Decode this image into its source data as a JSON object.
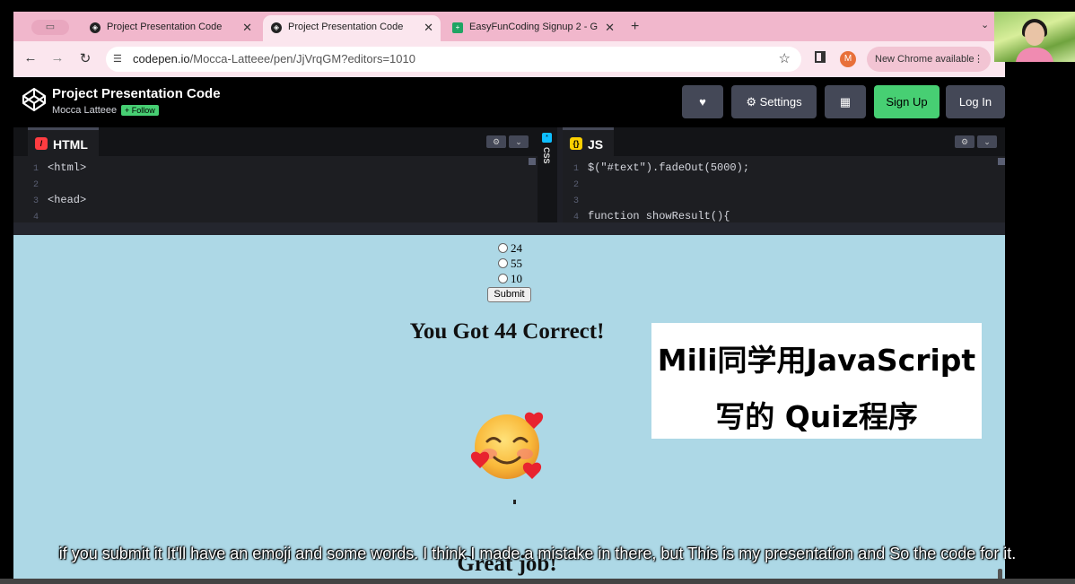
{
  "browser": {
    "tabs": [
      {
        "title": "Project Presentation Code",
        "active": false
      },
      {
        "title": "Project Presentation Code",
        "active": true
      },
      {
        "title": "EasyFunCoding Signup 2 - G",
        "active": false
      }
    ],
    "new_tab": "+",
    "tab_close": "✕",
    "url_domain": "codepen.io",
    "url_path": "/Mocca-Latteee/pen/JjVrqGM?editors=1010",
    "avatar_letter": "M",
    "update_label": "New Chrome available",
    "update_menu": "⋮"
  },
  "codepen": {
    "pen_title": "Project Presentation Code",
    "author": "Mocca Latteee",
    "follow_label": "+ Follow",
    "settings_label": "Settings",
    "signup_label": "Sign Up",
    "login_label": "Log In"
  },
  "editors": {
    "html": {
      "label": "HTML",
      "lines": [
        {
          "num": "1",
          "text": "<html>"
        },
        {
          "num": "2",
          "text": ""
        },
        {
          "num": "3",
          "text": "<head>"
        },
        {
          "num": "4",
          "text": ""
        }
      ]
    },
    "css": {
      "label": "CSS"
    },
    "js": {
      "label": "JS",
      "lines": [
        {
          "num": "1",
          "text": "$(\"#text\").fadeOut(5000);"
        },
        {
          "num": "2",
          "text": ""
        },
        {
          "num": "3",
          "text": ""
        },
        {
          "num": "4",
          "text": "function showResult(){"
        }
      ]
    }
  },
  "result": {
    "options": [
      "24",
      "55",
      "10"
    ],
    "submit_label": "Submit",
    "score_text": "You Got 44 Correct!",
    "message_text": "Great job!"
  },
  "overlay": {
    "line1": "Mili同学用JavaScript",
    "line2": "写的 Quiz程序"
  },
  "subtitle": "if you submit it It'll have an emoji and some words. I think I made a mistake in there, but This is my presentation and So the code for it.",
  "colors": {
    "tab_strip": "#f1b7cc",
    "result_background": "#add8e6",
    "signup_button": "#47cf73",
    "html_badge": "#ff3c41",
    "js_badge": "#fcd000",
    "css_badge": "#0ebeff"
  }
}
